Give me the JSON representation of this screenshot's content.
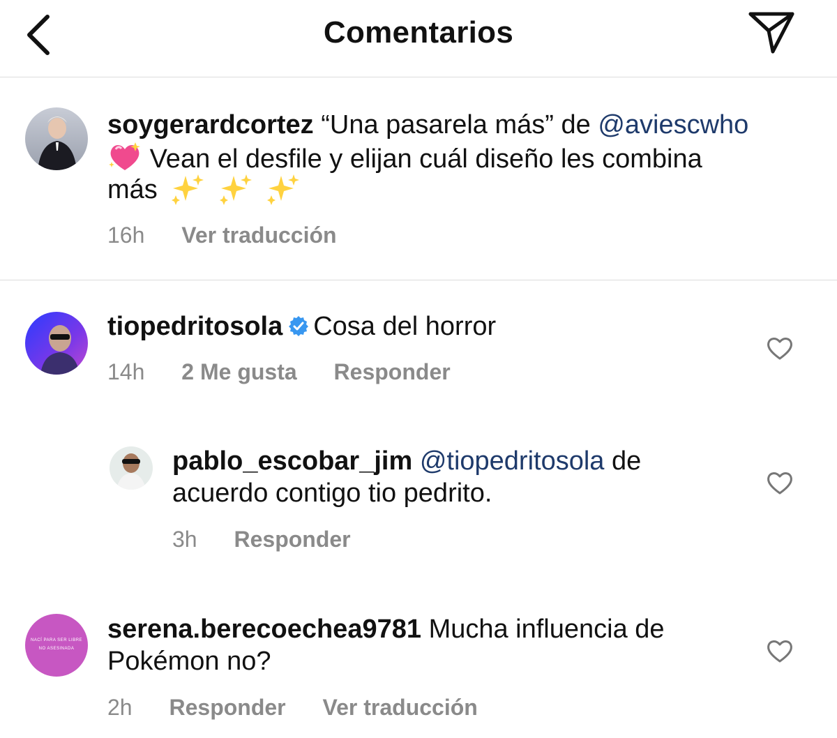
{
  "header": {
    "title": "Comentarios",
    "back_icon": "chevron-left-icon",
    "share_icon": "paper-plane-icon"
  },
  "caption": {
    "username": "soygerardcortez",
    "text_a": "“Una pasarela más” de",
    "mention": "@aviescwho",
    "emoji": "sparkling-heart-icon",
    "text_b": "Vean el desfile y elijan cuál diseño les combina",
    "text_c": "más",
    "trailing_emoji": "sparkles-icon",
    "time": "16h",
    "translate": "Ver traducción"
  },
  "comments": [
    {
      "username": "tiopedritosola",
      "verified": true,
      "text": "Cosa del horror",
      "time": "14h",
      "likes": "2 Me gusta",
      "reply": "Responder"
    },
    {
      "username": "pablo_escobar_jim",
      "mention": "@tiopedritosola",
      "text_a": "de",
      "text_b": "acuerdo contigo tio pedrito.",
      "time": "3h",
      "reply": "Responder"
    },
    {
      "username": "serena.berecoechea9781",
      "text_a": "Mucha influencia de",
      "text_b": "Pokémon no?",
      "time": "2h",
      "reply": "Responder",
      "translate": "Ver traducción",
      "avatar_text_1": "NACÍ PARA SER LIBRE",
      "avatar_text_2": "NO ASESINADA"
    }
  ],
  "colors": {
    "text": "#111111",
    "meta": "#8a8a8a",
    "mention": "#1e3a6b",
    "divider": "#dcdcdc",
    "verified": "#3897f0"
  }
}
